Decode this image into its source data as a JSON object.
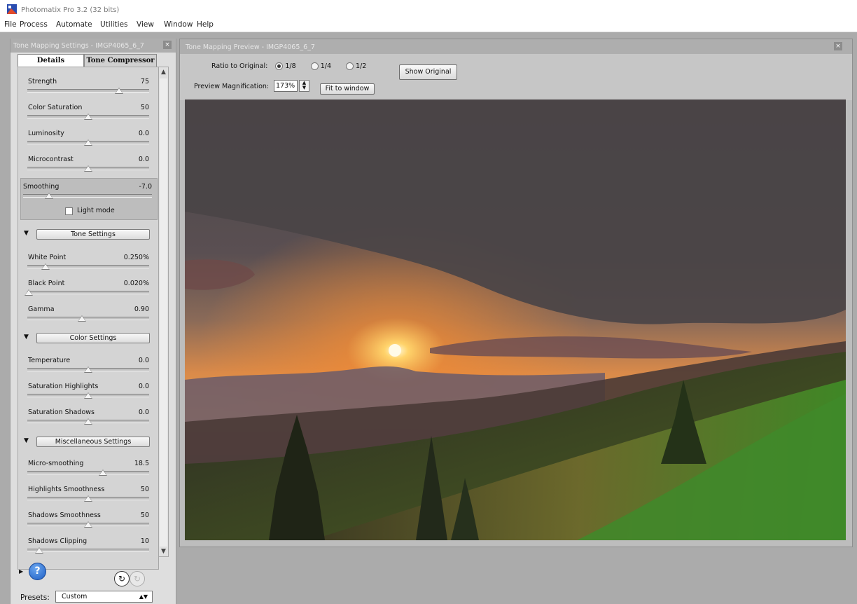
{
  "window": {
    "title": "Photomatix Pro 3.2 (32 bits)"
  },
  "menu": [
    "File",
    "Process",
    "Automate",
    "Utilities",
    "View",
    "Window",
    "Help"
  ],
  "settings_pane": {
    "title": "Tone Mapping Settings - IMGP4065_6_7",
    "close": "×",
    "tabs": [
      "Details Enhancer",
      "Tone Compressor"
    ],
    "sliders": [
      {
        "label": "Strength",
        "value": "75",
        "pos": 0.75
      },
      {
        "label": "Color Saturation",
        "value": "50",
        "pos": 0.5
      },
      {
        "label": "Luminosity",
        "value": "0.0",
        "pos": 0.5
      },
      {
        "label": "Microcontrast",
        "value": "0.0",
        "pos": 0.5
      },
      {
        "label": "Smoothing",
        "value": "-7.0",
        "pos": 0.2
      }
    ],
    "light_mode": "Light mode",
    "tone_settings": {
      "title": "Tone Settings",
      "sliders": [
        {
          "label": "White Point",
          "value": "0.250%",
          "pos": 0.15
        },
        {
          "label": "Black Point",
          "value": "0.020%",
          "pos": 0.01
        },
        {
          "label": "Gamma",
          "value": "0.90",
          "pos": 0.45
        }
      ]
    },
    "color_settings": {
      "title": "Color Settings",
      "sliders": [
        {
          "label": "Temperature",
          "value": "0.0",
          "pos": 0.5
        },
        {
          "label": "Saturation Highlights",
          "value": "0.0",
          "pos": 0.5
        },
        {
          "label": "Saturation Shadows",
          "value": "0.0",
          "pos": 0.5
        }
      ]
    },
    "misc_settings": {
      "title": "Miscellaneous Settings",
      "sliders": [
        {
          "label": "Micro-smoothing",
          "value": "18.5",
          "pos": 0.62
        },
        {
          "label": "Highlights Smoothness",
          "value": "50",
          "pos": 0.5
        },
        {
          "label": "Shadows Smoothness",
          "value": "50",
          "pos": 0.5
        },
        {
          "label": "Shadows Clipping",
          "value": "10",
          "pos": 0.1
        }
      ]
    },
    "help": "?",
    "presets_label": "Presets:",
    "presets_value": "Custom"
  },
  "preview": {
    "title": "Tone Mapping Preview - IMGP4065_6_7",
    "close": "×",
    "ratio_label": "Ratio to Original:",
    "ratio_options": [
      "1/8",
      "1/4",
      "1/2"
    ],
    "ratio_selected": "1/8",
    "show_original": "Show Original",
    "magnification_label": "Preview Magnification:",
    "magnification_value": "173%",
    "fit_to_window": "Fit to window"
  }
}
